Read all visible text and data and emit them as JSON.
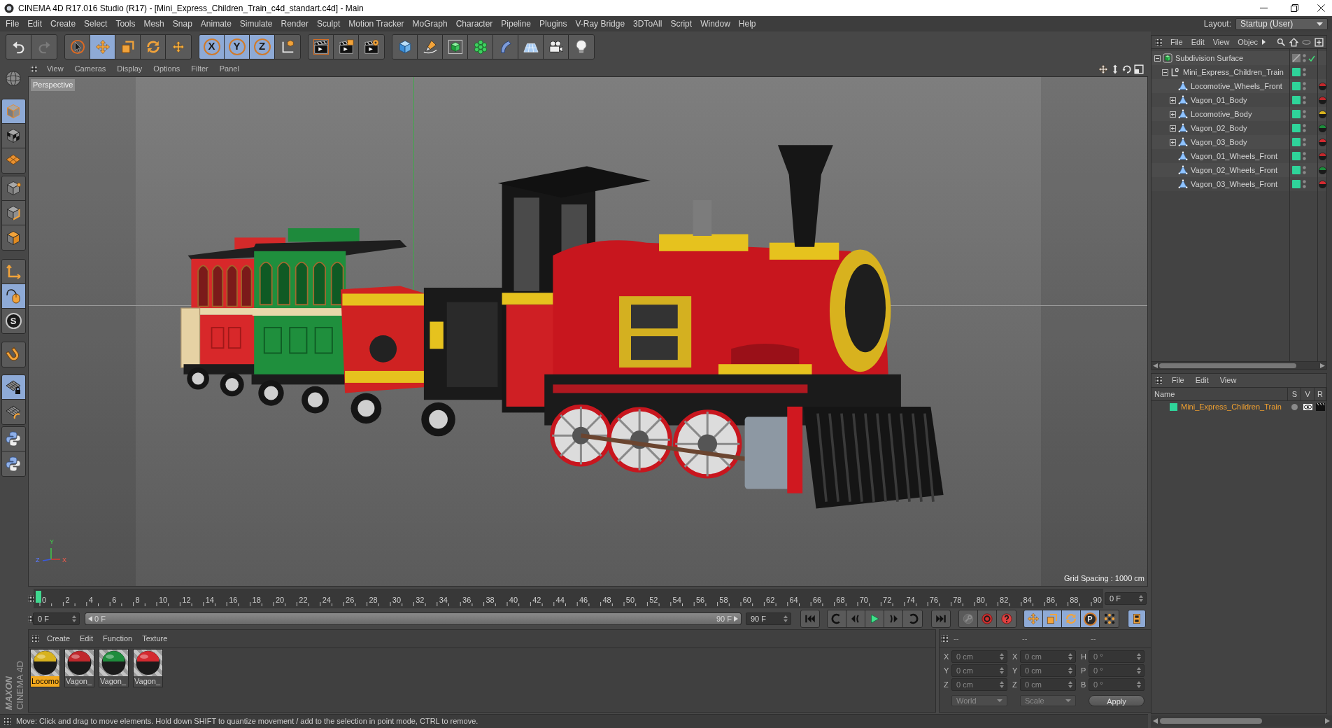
{
  "window": {
    "title": "CINEMA 4D R17.016 Studio (R17) - [Mini_Express_Children_Train_c4d_standart.c4d] - Main"
  },
  "menu_bar": {
    "items": [
      "File",
      "Edit",
      "Create",
      "Select",
      "Tools",
      "Mesh",
      "Snap",
      "Animate",
      "Simulate",
      "Render",
      "Sculpt",
      "Motion Tracker",
      "MoGraph",
      "Character",
      "Pipeline",
      "Plugins",
      "V-Ray Bridge",
      "3DToAll",
      "Script",
      "Window",
      "Help"
    ],
    "layout_label": "Layout:",
    "layout_value": "Startup (User)"
  },
  "toolbar": {
    "history": [
      {
        "disabled": false
      },
      {
        "disabled": true
      }
    ],
    "tools": [
      {
        "selected": false
      },
      {
        "selected": true
      },
      {
        "selected": false
      },
      {
        "selected": false
      },
      {
        "selected": false
      }
    ],
    "axes": [
      {
        "label": "X",
        "selected": true
      },
      {
        "label": "Y",
        "selected": true
      },
      {
        "label": "Z",
        "selected": true
      }
    ]
  },
  "mode_bar": {
    "tools": [
      {
        "selected": true
      },
      {
        "selected": false
      },
      {
        "selected": false
      },
      {
        "selected": false
      },
      {
        "selected": false
      },
      {
        "selected": false
      },
      {
        "selected": false
      },
      {
        "selected": true
      },
      {
        "label": "S",
        "selected": false
      },
      {
        "selected": false
      },
      {
        "selected": true
      },
      {
        "selected": false
      },
      {
        "selected": false
      },
      {
        "selected": false
      }
    ]
  },
  "viewport": {
    "menu": [
      "View",
      "Cameras",
      "Display",
      "Options",
      "Filter",
      "Panel"
    ],
    "camera": "Perspective",
    "grid_spacing": "Grid Spacing : 1000 cm",
    "axes": {
      "y": "Y",
      "z": "Z",
      "x": "X"
    }
  },
  "object_manager": {
    "menu": [
      "File",
      "Edit",
      "View",
      "Objec"
    ],
    "tree": [
      {
        "name": "Subdivision Surface",
        "kind": "subdivision",
        "expanded": true,
        "enabled": true,
        "children": [
          {
            "name": "Mini_Express_Children_Train",
            "kind": "null",
            "expanded": true,
            "children": [
              {
                "name": "Locomotive_Wheels_Front",
                "kind": "polygon",
                "color": "#c0282c"
              },
              {
                "name": "Vagon_01_Body",
                "kind": "polygon",
                "expanded": false,
                "color": "#c0282c"
              },
              {
                "name": "Locomotive_Body",
                "kind": "polygon",
                "expanded": false,
                "color": "#d8b21e"
              },
              {
                "name": "Vagon_02_Body",
                "kind": "polygon",
                "expanded": false,
                "color": "#1e8c3c"
              },
              {
                "name": "Vagon_03_Body",
                "kind": "polygon",
                "expanded": false,
                "color": "#d42a30"
              },
              {
                "name": "Vagon_01_Wheels_Front",
                "kind": "polygon",
                "color": "#c0282c"
              },
              {
                "name": "Vagon_02_Wheels_Front",
                "kind": "polygon",
                "color": "#1e8c3c"
              },
              {
                "name": "Vagon_03_Wheels_Front",
                "kind": "polygon",
                "color": "#d42a30"
              }
            ]
          }
        ]
      }
    ]
  },
  "layer_manager": {
    "menu": [
      "File",
      "Edit",
      "View"
    ],
    "columns": [
      "Name",
      "S",
      "V",
      "R"
    ],
    "rows": [
      {
        "name": "Mini_Express_Children_Train"
      }
    ]
  },
  "timeline": {
    "labels": [
      "0",
      "2",
      "4",
      "6",
      "8",
      "10",
      "12",
      "14",
      "16",
      "18",
      "20",
      "22",
      "24",
      "26",
      "28",
      "30",
      "32",
      "34",
      "36",
      "38",
      "40",
      "42",
      "44",
      "46",
      "48",
      "50",
      "52",
      "54",
      "56",
      "58",
      "60",
      "62",
      "64",
      "66",
      "68",
      "70",
      "72",
      "74",
      "76",
      "78",
      "80",
      "82",
      "84",
      "86",
      "88",
      "90"
    ],
    "level": 0,
    "frame_field": "0 F"
  },
  "playback": {
    "start_field": "0 F",
    "range": {
      "start": "0 F",
      "end": "90 F",
      "level": 1
    },
    "end_field": "90 F",
    "key_filters": [
      {
        "selected": true
      },
      {
        "selected": true
      },
      {
        "selected": true
      },
      {
        "label": "P",
        "selected": true
      },
      {
        "selected": false
      }
    ],
    "timeline_toggle": {
      "selected": true
    }
  },
  "materials": {
    "menu": [
      "Create",
      "Edit",
      "Function",
      "Texture"
    ],
    "items": [
      {
        "name": "Locomo",
        "selected": true,
        "color": "#d8b21e"
      },
      {
        "name": "Vagon_",
        "selected": false,
        "color": "#c0282c"
      },
      {
        "name": "Vagon_",
        "selected": false,
        "color": "#1e8c3c"
      },
      {
        "name": "Vagon_",
        "selected": false,
        "color": "#d42a30"
      }
    ]
  },
  "coordinates": {
    "headers": [
      "--",
      "--",
      "--"
    ],
    "columns": [
      [
        {
          "label": "X",
          "value": "0 cm"
        },
        {
          "label": "Y",
          "value": "0 cm"
        },
        {
          "label": "Z",
          "value": "0 cm"
        }
      ],
      [
        {
          "label": "X",
          "value": "0 cm"
        },
        {
          "label": "Y",
          "value": "0 cm"
        },
        {
          "label": "Z",
          "value": "0 cm"
        }
      ],
      [
        {
          "label": "H",
          "value": "0 °"
        },
        {
          "label": "P",
          "value": "0 °"
        },
        {
          "label": "B",
          "value": "0 °"
        }
      ]
    ],
    "dropdowns": [
      "World",
      "Scale"
    ],
    "apply": "Apply"
  },
  "logo": {
    "brand": "MAXON",
    "product": "CINEMA 4D"
  },
  "status_bar": {
    "text": "Move: Click and drag to move elements. Hold down SHIFT to quantize movement / add to the selection in point mode, CTRL to remove."
  }
}
